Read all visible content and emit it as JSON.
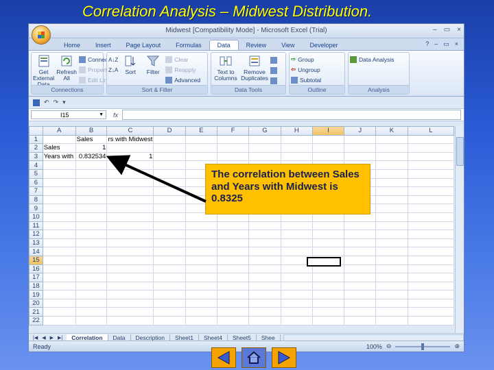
{
  "slide": {
    "title": "Correlation Analysis –  Midwest Distribution."
  },
  "window": {
    "title": "Midwest  [Compatibility Mode] - Microsoft Excel (Trial)",
    "controls": [
      "–",
      "▭",
      "×"
    ]
  },
  "ribbon_tabs": [
    "Home",
    "Insert",
    "Page Layout",
    "Formulas",
    "Data",
    "Review",
    "View",
    "Developer"
  ],
  "active_tab": "Data",
  "ribbon": {
    "get_external": "Get External Data",
    "refresh": "Refresh All",
    "connections": "Connections",
    "properties": "Properties",
    "edit_links": "Edit Links",
    "connections_group": "Connections",
    "sort": "Sort",
    "filter": "Filter",
    "clear": "Clear",
    "reapply": "Reapply",
    "advanced": "Advanced",
    "sort_filter_group": "Sort & Filter",
    "text_to_columns": "Text to Columns",
    "remove_duplicates": "Remove Duplicates",
    "data_tools_group": "Data Tools",
    "group": "Group",
    "ungroup": "Ungroup",
    "subtotal": "Subtotal",
    "outline_group": "Outline",
    "data_analysis": "Data Analysis",
    "analysis_group": "Analysis"
  },
  "formula_bar": {
    "name_box": "I15",
    "fx": "fx",
    "value": ""
  },
  "columns": [
    "A",
    "B",
    "C",
    "D",
    "E",
    "F",
    "G",
    "H",
    "I",
    "J",
    "K",
    "L"
  ],
  "rows": [
    "1",
    "2",
    "3",
    "4",
    "5",
    "6",
    "7",
    "8",
    "9",
    "10",
    "11",
    "12",
    "13",
    "14",
    "15",
    "16",
    "17",
    "18",
    "19",
    "20",
    "21",
    "22"
  ],
  "cells": {
    "B1": "Sales",
    "C1": "rs with Midwest",
    "A2": "Sales",
    "B2": "1",
    "A3": "Years with",
    "B3": "0.832534",
    "C3": "1"
  },
  "selected_cell": "I15",
  "sheet_tabs": [
    "Correlation",
    "Data",
    "Description",
    "Sheet1",
    "Sheet4",
    "Sheet5",
    "Shee"
  ],
  "active_sheet": "Correlation",
  "status": {
    "ready": "Ready",
    "zoom": "100%"
  },
  "callout": {
    "text": "The correlation between Sales and Years with Midwest is 0.8325"
  },
  "colors": {
    "callout_bg": "#ffc000",
    "title_color": "#ffff00",
    "nav_button": "#f5a300"
  }
}
